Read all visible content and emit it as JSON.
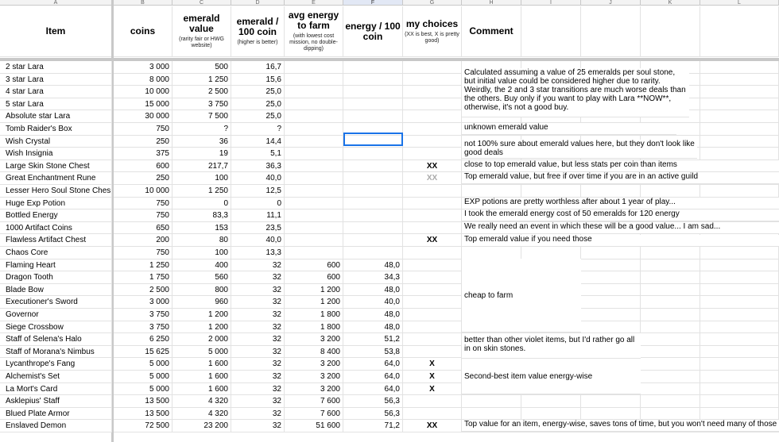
{
  "col_letters": [
    "A",
    "B",
    "C",
    "D",
    "E",
    "F",
    "G",
    "H",
    "I",
    "J",
    "K",
    "L"
  ],
  "header": {
    "item": "Item",
    "coins": "coins",
    "emerald_value": "emerald value",
    "emerald_value_note": "(rarity fair or HWG website)",
    "emerald_per_100": "emerald / 100 coin",
    "emerald_per_100_note": "(higher is better)",
    "avg_energy": "avg energy to farm",
    "avg_energy_note": "(with lowest cost mission, no double-dipping)",
    "energy_per_100": "energy / 100 coin",
    "my_choices": "my choices",
    "my_choices_note": "(XX is best, X is pretty good)",
    "comment": "Comment"
  },
  "rows": [
    {
      "item": "2 star Lara",
      "coins": "3 000",
      "ev": "500",
      "e100": "16,7",
      "energy": "",
      "en100": "",
      "choice": ""
    },
    {
      "item": "3 star Lara",
      "coins": "8 000",
      "ev": "1 250",
      "e100": "15,6",
      "energy": "",
      "en100": "",
      "choice": ""
    },
    {
      "item": "4 star Lara",
      "coins": "10 000",
      "ev": "2 500",
      "e100": "25,0",
      "energy": "",
      "en100": "",
      "choice": ""
    },
    {
      "item": "5 star Lara",
      "coins": "15 000",
      "ev": "3 750",
      "e100": "25,0",
      "energy": "",
      "en100": "",
      "choice": ""
    },
    {
      "item": "Absolute star Lara",
      "coins": "30 000",
      "ev": "7 500",
      "e100": "25,0",
      "energy": "",
      "en100": "",
      "choice": ""
    },
    {
      "item": "Tomb Raider's Box",
      "coins": "750",
      "ev": "?",
      "e100": "?",
      "energy": "",
      "en100": "",
      "choice": ""
    },
    {
      "item": "Wish Crystal",
      "coins": "250",
      "ev": "36",
      "e100": "14,4",
      "energy": "",
      "en100": "",
      "choice": ""
    },
    {
      "item": "Wish Insignia",
      "coins": "375",
      "ev": "19",
      "e100": "5,1",
      "energy": "",
      "en100": "",
      "choice": ""
    },
    {
      "item": "Large Skin Stone Chest",
      "coins": "600",
      "ev": "217,7",
      "e100": "36,3",
      "energy": "",
      "en100": "",
      "choice": "XX"
    },
    {
      "item": "Great Enchantment Rune",
      "coins": "250",
      "ev": "100",
      "e100": "40,0",
      "energy": "",
      "en100": "",
      "choice": "XX"
    },
    {
      "item": "Lesser Hero Soul Stone Ches",
      "coins": "10 000",
      "ev": "1 250",
      "e100": "12,5",
      "energy": "",
      "en100": "",
      "choice": ""
    },
    {
      "item": "Huge Exp Potion",
      "coins": "750",
      "ev": "0",
      "e100": "0",
      "energy": "",
      "en100": "",
      "choice": ""
    },
    {
      "item": "Bottled Energy",
      "coins": "750",
      "ev": "83,3",
      "e100": "11,1",
      "energy": "",
      "en100": "",
      "choice": ""
    },
    {
      "item": "1000 Artifact Coins",
      "coins": "650",
      "ev": "153",
      "e100": "23,5",
      "energy": "",
      "en100": "",
      "choice": ""
    },
    {
      "item": "Flawless Artifact Chest",
      "coins": "200",
      "ev": "80",
      "e100": "40,0",
      "energy": "",
      "en100": "",
      "choice": "XX"
    },
    {
      "item": "Chaos Core",
      "coins": "750",
      "ev": "100",
      "e100": "13,3",
      "energy": "",
      "en100": "",
      "choice": ""
    },
    {
      "item": "Flaming Heart",
      "coins": "1 250",
      "ev": "400",
      "e100": "32",
      "energy": "600",
      "en100": "48,0",
      "choice": ""
    },
    {
      "item": "Dragon Tooth",
      "coins": "1 750",
      "ev": "560",
      "e100": "32",
      "energy": "600",
      "en100": "34,3",
      "choice": ""
    },
    {
      "item": "Blade Bow",
      "coins": "2 500",
      "ev": "800",
      "e100": "32",
      "energy": "1 200",
      "en100": "48,0",
      "choice": ""
    },
    {
      "item": "Executioner's Sword",
      "coins": "3 000",
      "ev": "960",
      "e100": "32",
      "energy": "1 200",
      "en100": "40,0",
      "choice": ""
    },
    {
      "item": "Governor",
      "coins": "3 750",
      "ev": "1 200",
      "e100": "32",
      "energy": "1 800",
      "en100": "48,0",
      "choice": ""
    },
    {
      "item": "Siege Crossbow",
      "coins": "3 750",
      "ev": "1 200",
      "e100": "32",
      "energy": "1 800",
      "en100": "48,0",
      "choice": ""
    },
    {
      "item": "Staff of Selena's Halo",
      "coins": "6 250",
      "ev": "2 000",
      "e100": "32",
      "energy": "3 200",
      "en100": "51,2",
      "choice": ""
    },
    {
      "item": "Staff of Morana's Nimbus",
      "coins": "15 625",
      "ev": "5 000",
      "e100": "32",
      "energy": "8 400",
      "en100": "53,8",
      "choice": ""
    },
    {
      "item": "Lycanthrope's Fang",
      "coins": "5 000",
      "ev": "1 600",
      "e100": "32",
      "energy": "3 200",
      "en100": "64,0",
      "choice": "X"
    },
    {
      "item": "Alchemist's Set",
      "coins": "5 000",
      "ev": "1 600",
      "e100": "32",
      "energy": "3 200",
      "en100": "64,0",
      "choice": "X"
    },
    {
      "item": "La Mort's Card",
      "coins": "5 000",
      "ev": "1 600",
      "e100": "32",
      "energy": "3 200",
      "en100": "64,0",
      "choice": "X"
    },
    {
      "item": "Asklepius' Staff",
      "coins": "13 500",
      "ev": "4 320",
      "e100": "32",
      "energy": "7 600",
      "en100": "56,3",
      "choice": ""
    },
    {
      "item": "Blued Plate Armor",
      "coins": "13 500",
      "ev": "4 320",
      "e100": "32",
      "energy": "7 600",
      "en100": "56,3",
      "choice": ""
    },
    {
      "item": "Enslaved Demon",
      "coins": "72 500",
      "ev": "23 200",
      "e100": "32",
      "energy": "51 600",
      "en100": "71,2",
      "choice": "XX"
    }
  ],
  "comments": {
    "lara": "Calculated assuming a value of 25 emeralds per soul stone, but initial value could be considered higher due to rarity. Weirdly, the 2 and 3 star transitions are much worse deals than the others. Buy only if you want to play with Lara **NOW**, otherwise, it's not a good buy.",
    "tomb": "unknown emerald value",
    "wish": "not 100% sure about emerald values here, but they don't look like good deals",
    "skin": "close to top emerald value, but less stats per coin than items",
    "rune": "Top emerald value, but free if over time if you are in an active guild",
    "exp": "EXP potions are pretty worthless after about 1 year of play...",
    "bottled": "I took the emerald energy cost of 50 emeralds for 120 energy",
    "artifact": "We really need an event in which these will be a good value... I am sad...",
    "flawless": "Top emerald value if you need those",
    "cheap": "cheap to farm",
    "violet": "better than other violet items, but I'd rather go all in on skin stones.",
    "second": "Second-best item value energy-wise",
    "demon": "Top value for an item, energy-wise, saves tons of time, but you won't need many of those"
  },
  "light_choice_rows": [
    9
  ]
}
